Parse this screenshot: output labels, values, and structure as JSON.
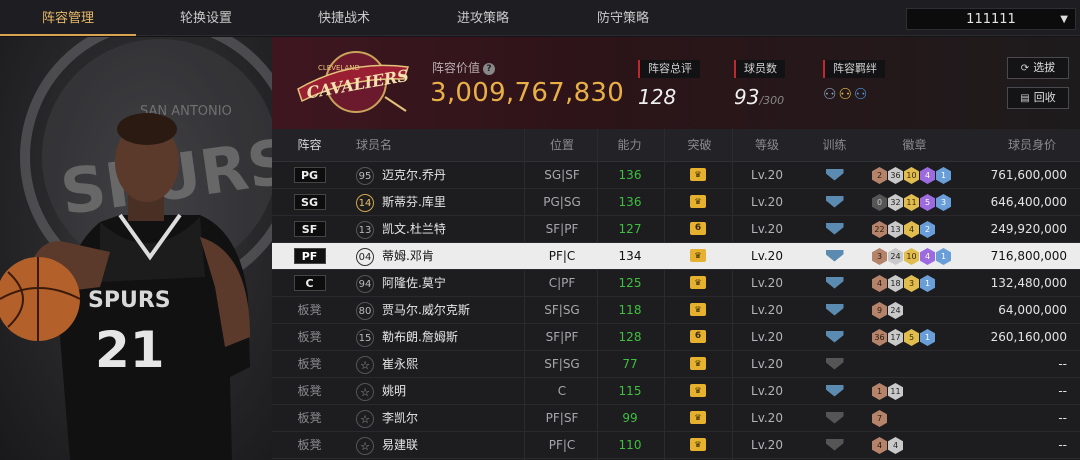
{
  "nav": {
    "tabs": [
      "阵容管理",
      "轮换设置",
      "快捷战术",
      "进攻策略",
      "防守策略"
    ],
    "active": 0,
    "team_select": "111111"
  },
  "header": {
    "value_label": "阵容价值",
    "value": "3,009,767,830",
    "rating_label": "阵容总评",
    "rating": "128",
    "players_label": "球员数",
    "players": "93",
    "players_max": "/300",
    "bond_label": "阵容羁绊",
    "btn_scout": "选拔",
    "btn_recycle": "回收"
  },
  "table": {
    "headers": [
      "阵容",
      "球员名",
      "位置",
      "能力",
      "突破",
      "等级",
      "训练",
      "徽章",
      "球员身价"
    ],
    "rows": [
      {
        "slot": "PG",
        "num": "95",
        "name": "迈克尔.乔丹",
        "pos": "SG|SF",
        "ability": "136",
        "breakthrough": "crown",
        "level": "Lv.20",
        "training": "blue",
        "badges": [
          [
            "br",
            "2"
          ],
          [
            "sv",
            "36"
          ],
          [
            "gd",
            "10"
          ],
          [
            "pu",
            "4"
          ],
          [
            "bl",
            "1"
          ]
        ],
        "worth": "761,600,000"
      },
      {
        "slot": "SG",
        "num": "14",
        "name": "斯蒂芬.库里",
        "pos": "PG|SG",
        "ability": "136",
        "breakthrough": "crown",
        "level": "Lv.20",
        "training": "blue",
        "badges": [
          [
            "dk",
            "0"
          ],
          [
            "sv",
            "32"
          ],
          [
            "gd",
            "11"
          ],
          [
            "pu",
            "5"
          ],
          [
            "bl",
            "3"
          ]
        ],
        "worth": "646,400,000"
      },
      {
        "slot": "SF",
        "num": "13",
        "name": "凯文.杜兰特",
        "pos": "SF|PF",
        "ability": "127",
        "breakthrough": "6",
        "level": "Lv.20",
        "training": "blue",
        "badges": [
          [
            "br",
            "22"
          ],
          [
            "sv",
            "13"
          ],
          [
            "gd",
            "4"
          ],
          [
            "bl",
            "2"
          ]
        ],
        "worth": "249,920,000"
      },
      {
        "slot": "PF",
        "num": "04",
        "name": "蒂姆.邓肯",
        "pos": "PF|C",
        "ability": "134",
        "breakthrough": "crown",
        "level": "Lv.20",
        "training": "blue",
        "badges": [
          [
            "br",
            "3"
          ],
          [
            "sv",
            "24"
          ],
          [
            "gd",
            "10"
          ],
          [
            "pu",
            "4"
          ],
          [
            "bl",
            "1"
          ]
        ],
        "worth": "716,800,000"
      },
      {
        "slot": "C",
        "num": "94",
        "name": "阿隆佐.莫宁",
        "pos": "C|PF",
        "ability": "125",
        "breakthrough": "crown",
        "level": "Lv.20",
        "training": "blue",
        "badges": [
          [
            "br",
            "4"
          ],
          [
            "sv",
            "18"
          ],
          [
            "gd",
            "3"
          ],
          [
            "bl",
            "1"
          ]
        ],
        "worth": "132,480,000"
      },
      {
        "slot": "板凳",
        "num": "80",
        "name": "贾马尔.威尔克斯",
        "pos": "SF|SG",
        "ability": "118",
        "breakthrough": "crown",
        "level": "Lv.20",
        "training": "blue",
        "badges": [
          [
            "br",
            "9"
          ],
          [
            "sv",
            "24"
          ]
        ],
        "worth": "64,000,000"
      },
      {
        "slot": "板凳",
        "num": "15",
        "name": "勒布朗.詹姆斯",
        "pos": "SF|PF",
        "ability": "128",
        "breakthrough": "6",
        "level": "Lv.20",
        "training": "blue",
        "badges": [
          [
            "br",
            "36"
          ],
          [
            "sv",
            "17"
          ],
          [
            "gd",
            "5"
          ],
          [
            "bl",
            "1"
          ]
        ],
        "worth": "260,160,000"
      },
      {
        "slot": "板凳",
        "num": "☆",
        "name": "崔永熙",
        "pos": "SF|SG",
        "ability": "77",
        "breakthrough": "crown",
        "level": "Lv.20",
        "training": "grey",
        "badges": [],
        "worth": "--"
      },
      {
        "slot": "板凳",
        "num": "☆",
        "name": "姚明",
        "pos": "C",
        "ability": "115",
        "breakthrough": "crown",
        "level": "Lv.20",
        "training": "blue",
        "badges": [
          [
            "br",
            "1"
          ],
          [
            "sv",
            "11"
          ]
        ],
        "worth": "--"
      },
      {
        "slot": "板凳",
        "num": "☆",
        "name": "李凯尔",
        "pos": "PF|SF",
        "ability": "99",
        "breakthrough": "crown",
        "level": "Lv.20",
        "training": "grey",
        "badges": [
          [
            "br",
            "7"
          ]
        ],
        "worth": "--"
      },
      {
        "slot": "板凳",
        "num": "☆",
        "name": "易建联",
        "pos": "PF|C",
        "ability": "110",
        "breakthrough": "crown",
        "level": "Lv.20",
        "training": "grey",
        "badges": [
          [
            "br",
            "4"
          ],
          [
            "sv",
            "4"
          ]
        ],
        "worth": "--"
      }
    ]
  },
  "logo": {
    "line1": "CLEVELAND",
    "line2": "CAVALIERS"
  },
  "player_art": {
    "jersey_team": "SPURS",
    "jersey_num": "21",
    "bg_text": "SPURS",
    "bg_text2": "SAN ANTONIO"
  }
}
